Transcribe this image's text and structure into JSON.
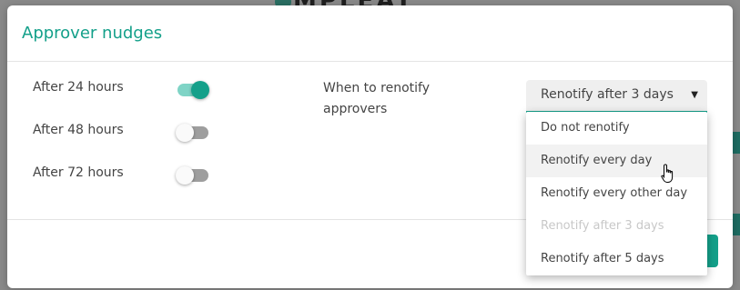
{
  "background": {
    "logo_text": "MPLEAT"
  },
  "modal": {
    "title": "Approver nudges",
    "settings": [
      {
        "label": "After 24 hours",
        "enabled": true
      },
      {
        "label": "After 48 hours",
        "enabled": false
      },
      {
        "label": "After 72 hours",
        "enabled": false
      }
    ],
    "renotify_label": "When to renotify approvers",
    "renotify_select": {
      "value": "Renotify after 3 days",
      "options": [
        {
          "label": "Do not renotify",
          "state": "normal"
        },
        {
          "label": "Renotify every day",
          "state": "hover"
        },
        {
          "label": "Renotify every other day",
          "state": "normal"
        },
        {
          "label": "Renotify after 3 days",
          "state": "disabled"
        },
        {
          "label": "Renotify after 5 days",
          "state": "normal"
        }
      ]
    }
  },
  "colors": {
    "accent": "#14a08a",
    "toggle_on_track": "#7fd4c6",
    "toggle_off_track": "#9e9e9e"
  },
  "icons": {
    "dropdown_caret": "chevron-down-icon",
    "cursor": "hand-pointer-icon"
  }
}
